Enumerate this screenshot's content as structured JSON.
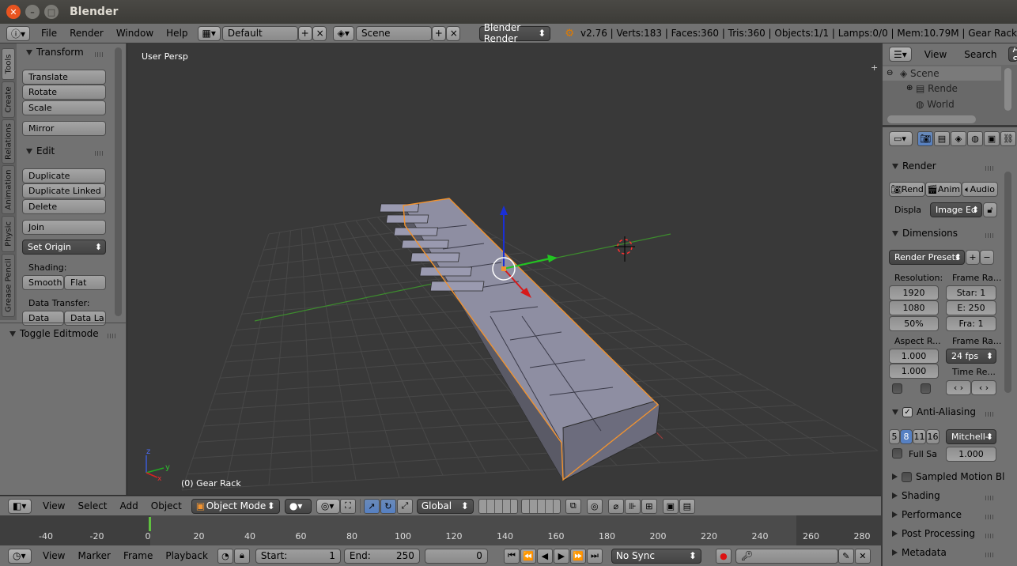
{
  "window": {
    "title": "Blender"
  },
  "info": {
    "menus": [
      "File",
      "Render",
      "Window",
      "Help"
    ],
    "screen_layout": "Default",
    "scene": "Scene",
    "engine": "Blender Render",
    "stats": "v2.76 | Verts:183 | Faces:360 | Tris:360 | Objects:1/1 | Lamps:0/0 | Mem:10.79M | Gear Rack"
  },
  "tabs": [
    "Tools",
    "Create",
    "Relations",
    "Animation",
    "Physic",
    "Grease Pencil"
  ],
  "tools": {
    "transform_title": "Transform",
    "translate": "Translate",
    "rotate": "Rotate",
    "scale": "Scale",
    "mirror": "Mirror",
    "edit_title": "Edit",
    "duplicate": "Duplicate",
    "duplicate_linked": "Duplicate Linked",
    "delete": "Delete",
    "join": "Join",
    "set_origin": "Set Origin",
    "shading_label": "Shading:",
    "smooth": "Smooth",
    "flat": "Flat",
    "data_transfer_label": "Data Transfer:",
    "data": "Data",
    "data_layers": "Data La",
    "toggle_editmode": "Toggle Editmode"
  },
  "viewport": {
    "view_name": "User Persp",
    "object_label": "(0) Gear Rack",
    "axis_x": "x",
    "axis_y": "y",
    "axis_z": "z"
  },
  "header3d": {
    "menus": [
      "View",
      "Select",
      "Add",
      "Object"
    ],
    "mode": "Object Mode",
    "orientation": "Global"
  },
  "timeline": {
    "ticks": [
      "-40",
      "-20",
      "0",
      "20",
      "40",
      "60",
      "80",
      "100",
      "120",
      "140",
      "160",
      "180",
      "200",
      "220",
      "240",
      "260",
      "280"
    ],
    "menus": [
      "View",
      "Marker",
      "Frame",
      "Playback"
    ],
    "start": "Start:",
    "start_val": "1",
    "end": "End:",
    "end_val": "250",
    "current": "0",
    "sync": "No Sync"
  },
  "outliner": {
    "menus": [
      "View",
      "Search"
    ],
    "filter": "All S",
    "items": [
      "Scene",
      "Rende",
      "World"
    ]
  },
  "properties": {
    "render_title": "Render",
    "render_btn": "Rend",
    "anim_btn": "Anim",
    "audio_btn": "Audio",
    "display_label": "Displa",
    "display_val": "Image Ed",
    "dimensions_title": "Dimensions",
    "render_presets": "Render Presets",
    "resolution_label": "Resolution:",
    "res_x": "1920",
    "res_y": "1080",
    "res_pct": "50%",
    "frame_range_label": "Frame Ra...",
    "frame_start": "Star: 1",
    "frame_end": "E: 250",
    "frame_step": "Fra: 1",
    "aspect_label": "Aspect R...",
    "aspect_x": "1.000",
    "aspect_y": "1.000",
    "frame_rate_label": "Frame Ra...",
    "fps": "24 fps",
    "time_remap_label": "Time Re...",
    "aa_title": "Anti-Aliasing",
    "aa_samples": [
      "5",
      "8",
      "11",
      "16"
    ],
    "aa_filter": "Mitchell-",
    "full_sample": "Full Sa",
    "filter_size": "1.000",
    "motion_blur": "Sampled Motion Bl",
    "shading": "Shading",
    "performance": "Performance",
    "post_processing": "Post Processing",
    "metadata": "Metadata"
  },
  "colors": {
    "grid": "#484848",
    "x_axis": "#9a3c3c",
    "y_axis": "#3d8c2e",
    "selection": "#f19330",
    "mesh": "#77778a"
  }
}
